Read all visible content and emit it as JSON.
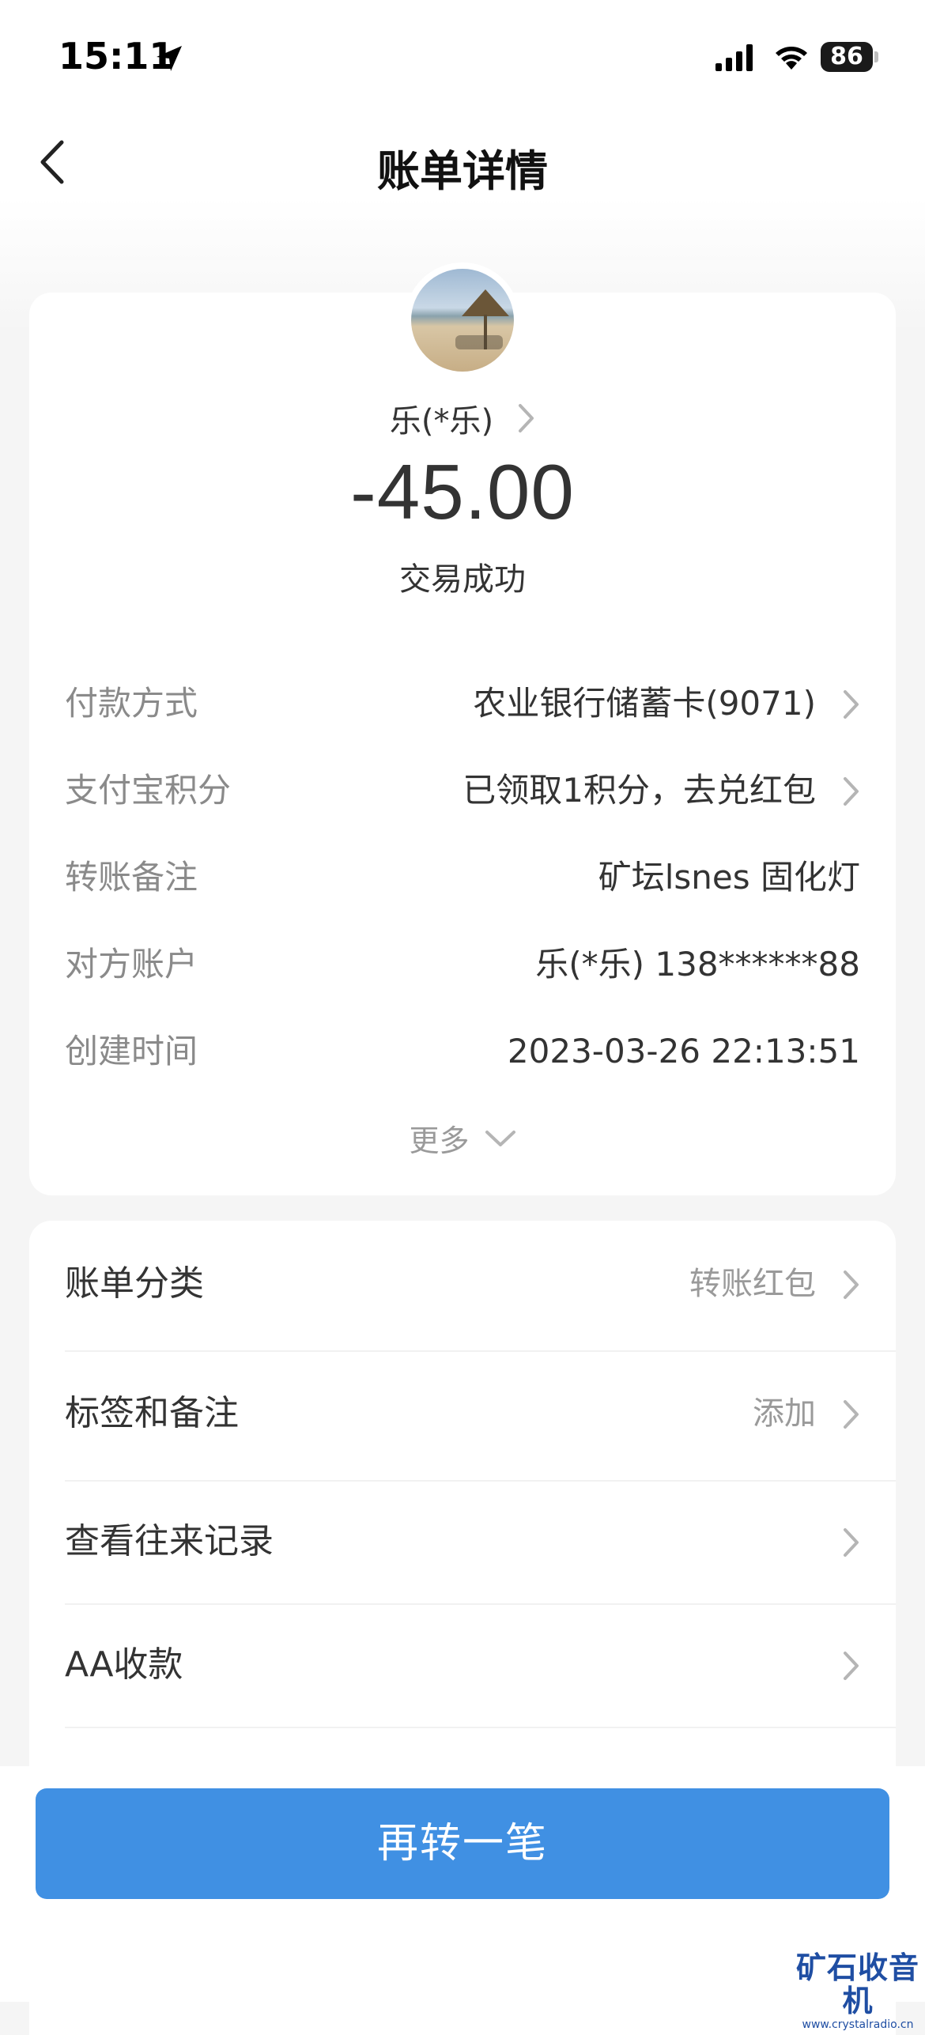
{
  "status_bar": {
    "time": "15:11",
    "battery": "86"
  },
  "header": {
    "title": "账单详情"
  },
  "transaction": {
    "payee": "乐(*乐)",
    "amount": "-45.00",
    "status": "交易成功"
  },
  "details": [
    {
      "label": "付款方式",
      "value": "农业银行储蓄卡(9071)",
      "has_arrow": true
    },
    {
      "label": "支付宝积分",
      "value": "已领取1积分，去兑红包",
      "has_arrow": true
    },
    {
      "label": "转账备注",
      "value": "矿坛lsnes 固化灯",
      "has_arrow": false
    },
    {
      "label": "对方账户",
      "value": "乐(*乐) 138******88",
      "has_arrow": false
    },
    {
      "label": "创建时间",
      "value": "2023-03-26 22:13:51",
      "has_arrow": false
    }
  ],
  "more_label": "更多",
  "menu": [
    {
      "label": "账单分类",
      "value": "转账红包"
    },
    {
      "label": "标签和备注",
      "value": "添加"
    },
    {
      "label": "查看往来记录",
      "value": ""
    },
    {
      "label": "AA收款",
      "value": ""
    }
  ],
  "cta": {
    "label": "再转一笔"
  },
  "watermark": {
    "main": "矿石收音机",
    "sub": "www.crystalradio.cn"
  },
  "colors": {
    "accent": "#4090e3",
    "label_gray": "#8a8a8a",
    "background": "#f5f5f5"
  },
  "icons": [
    "location-arrow-icon",
    "signal-icon",
    "wifi-icon",
    "battery-icon",
    "back-arrow-icon",
    "chevron-right-icon",
    "chevron-down-icon"
  ]
}
